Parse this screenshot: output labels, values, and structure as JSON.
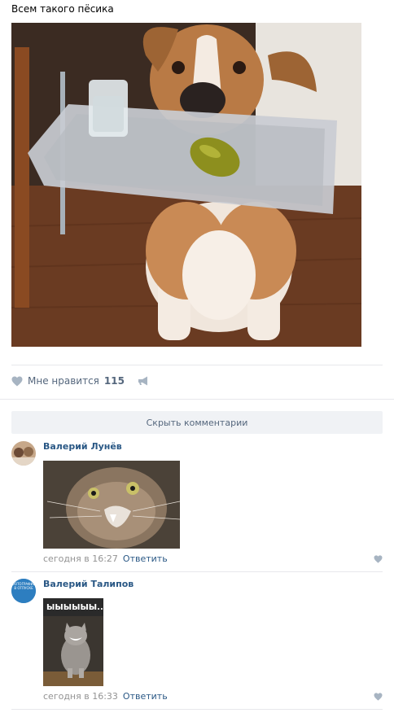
{
  "post": {
    "text": "Всем такого пёсика",
    "likes_label": "Мне нравится",
    "likes_count": "115"
  },
  "comments_toggle": "Скрыть комментарии",
  "comments": [
    {
      "author": "Валерий Лунёв",
      "time": "сегодня в 16:27",
      "reply_label": "Ответить"
    },
    {
      "author": "Валерий Талипов",
      "time": "сегодня в 16:33",
      "reply_label": "Ответить",
      "avatar_text": "ФОТОГРАФИИ В ОТПУСКЕ",
      "image_caption": "ЫЫЫЫЫЫ.."
    }
  ],
  "colors": {
    "link": "#2a5885",
    "muted": "#939393",
    "icon": "#a7b4c2",
    "button_bg": "#f0f2f5"
  }
}
